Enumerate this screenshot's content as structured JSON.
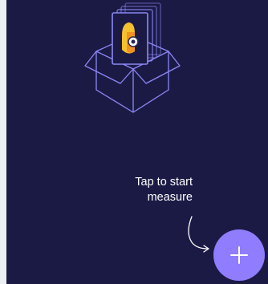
{
  "empty_state": {
    "hint_line1": "Tap to start",
    "hint_line2": "measure",
    "illustration_icon": "box-with-layered-cards-icon",
    "arrow_icon": "curved-arrow-icon"
  },
  "fab": {
    "icon": "plus-icon"
  },
  "colors": {
    "background": "#1b1a45",
    "accent": "#8f7cff",
    "outline": "#8d88f5",
    "card_yellow": "#f6c12e",
    "card_orange": "#f0921f",
    "text": "#ffffff"
  }
}
